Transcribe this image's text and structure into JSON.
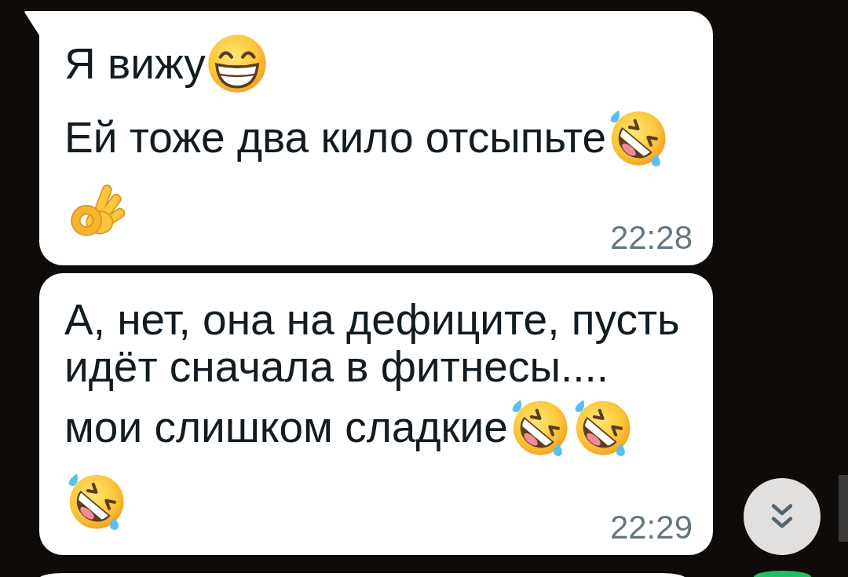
{
  "messages": [
    {
      "kind": "message",
      "tail": true,
      "lines": [
        {
          "parts": [
            {
              "kind": "text",
              "text": "Я вижу"
            },
            {
              "kind": "grin"
            }
          ]
        },
        {
          "parts": [
            {
              "kind": "text",
              "text": "Ей тоже два кило отсыпьте"
            },
            {
              "kind": "rofl"
            }
          ]
        },
        {
          "parts": [
            {
              "kind": "okhand"
            }
          ]
        }
      ],
      "time": "22:28"
    },
    {
      "kind": "message",
      "tail": false,
      "lines": [
        {
          "parts": [
            {
              "kind": "text",
              "text": "А, нет, она на дефиците, пусть"
            }
          ]
        },
        {
          "parts": [
            {
              "kind": "text",
              "text": "идёт сначала в фитнесы...."
            }
          ]
        },
        {
          "parts": [
            {
              "kind": "text",
              "text": "мои слишком сладкие"
            },
            {
              "kind": "rofl"
            },
            {
              "kind": "rofl"
            }
          ]
        },
        {
          "parts": [
            {
              "kind": "rofl"
            }
          ]
        }
      ],
      "time": "22:29"
    },
    {
      "kind": "clipped",
      "tail": false
    }
  ]
}
